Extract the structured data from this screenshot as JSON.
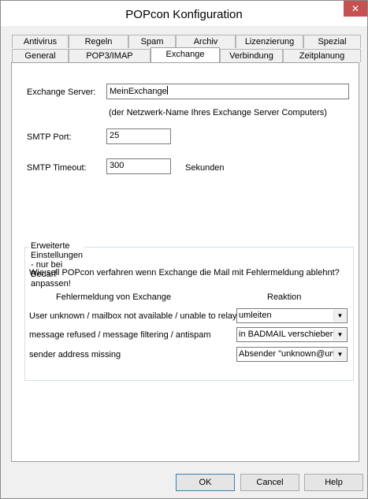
{
  "window": {
    "title": "POPcon Konfiguration"
  },
  "tabs_row1": [
    "Antivirus",
    "Regeln",
    "Spam",
    "Archiv",
    "Lizenzierung",
    "Spezial"
  ],
  "tabs_row2": [
    "General",
    "POP3/IMAP",
    "Exchange",
    "Verbindung",
    "Zeitplanung"
  ],
  "active_tab": "Exchange",
  "exchange": {
    "server_label": "Exchange Server:",
    "server_value": "MeinExchange",
    "server_hint": "(der Netzwerk-Name Ihres Exchange Server Computers)",
    "smtp_port_label": "SMTP Port:",
    "smtp_port_value": "25",
    "smtp_timeout_label": "SMTP Timeout:",
    "smtp_timeout_value": "300",
    "smtp_timeout_unit": "Sekunden"
  },
  "advanced": {
    "title": "Erweiterte Einstellungen - nur bei Bedarf anpassen!",
    "question": "Wie soll POPcon verfahren wenn Exchange die Mail mit Fehlermeldung ablehnt?",
    "col_error": "Fehlermeldung von Exchange",
    "col_reaction": "Reaktion",
    "rows": [
      {
        "error": "User unknown / mailbox not available / unable to relay",
        "reaction": "umleiten"
      },
      {
        "error": "message refused / message filtering / antispam",
        "reaction": "in BADMAIL verschieben"
      },
      {
        "error": "sender address missing",
        "reaction": "Absender \"unknown@un"
      }
    ]
  },
  "buttons": {
    "ok": "OK",
    "cancel": "Cancel",
    "help": "Help"
  },
  "icons": {
    "close": "close-icon",
    "dropdown": "chevron-down-icon"
  }
}
